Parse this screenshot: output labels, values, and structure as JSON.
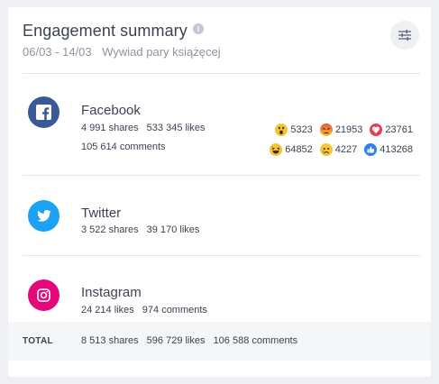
{
  "header": {
    "title": "Engagement summary",
    "info_icon": "info-icon",
    "date_range": "06/03 - 14/03",
    "project": "Wywiad pary książęcej",
    "settings_icon": "sliders-icon"
  },
  "networks": {
    "facebook": {
      "name": "Facebook",
      "color": "#3b5998",
      "shares": "4 991 shares",
      "likes": "533 345 likes",
      "comments": "105 614 comments",
      "reactions": {
        "wow": "5323",
        "angry": "21953",
        "love": "23761",
        "haha": "64852",
        "sad": "4227",
        "like": "413268"
      }
    },
    "twitter": {
      "name": "Twitter",
      "color": "#1da1f2",
      "shares": "3 522 shares",
      "likes": "39 170 likes"
    },
    "instagram": {
      "name": "Instagram",
      "color": "#e4087a",
      "likes": "24 214 likes",
      "comments": "974 comments"
    }
  },
  "total": {
    "label": "TOTAL",
    "shares": "8 513 shares",
    "likes": "596 729 likes",
    "comments": "106 588 comments"
  }
}
